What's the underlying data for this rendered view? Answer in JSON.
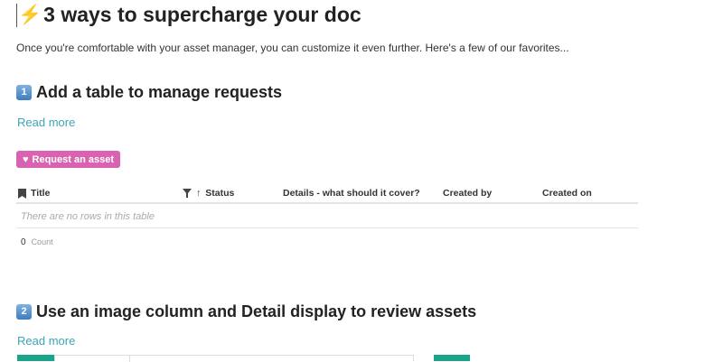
{
  "title": "3 ways to supercharge your doc",
  "intro": "Once you're comfortable with your asset manager, you can customize it even further. Here's a few of our favorites...",
  "section1": {
    "number": "1",
    "heading": "Add a table to manage requests",
    "read_more": "Read more",
    "button": "Request an asset",
    "columns": [
      "Title",
      "Status",
      "Details - what should it cover?",
      "Created by",
      "Created on"
    ],
    "empty": "There are no rows in this table",
    "count_value": "0",
    "count_label": "Count"
  },
  "section2": {
    "number": "2",
    "heading": "Use an image column  and Detail display to review assets",
    "read_more": "Read more"
  },
  "colors": {
    "accent": "#d963b0",
    "link": "#3ba6b8",
    "green": "#1aa58a"
  }
}
